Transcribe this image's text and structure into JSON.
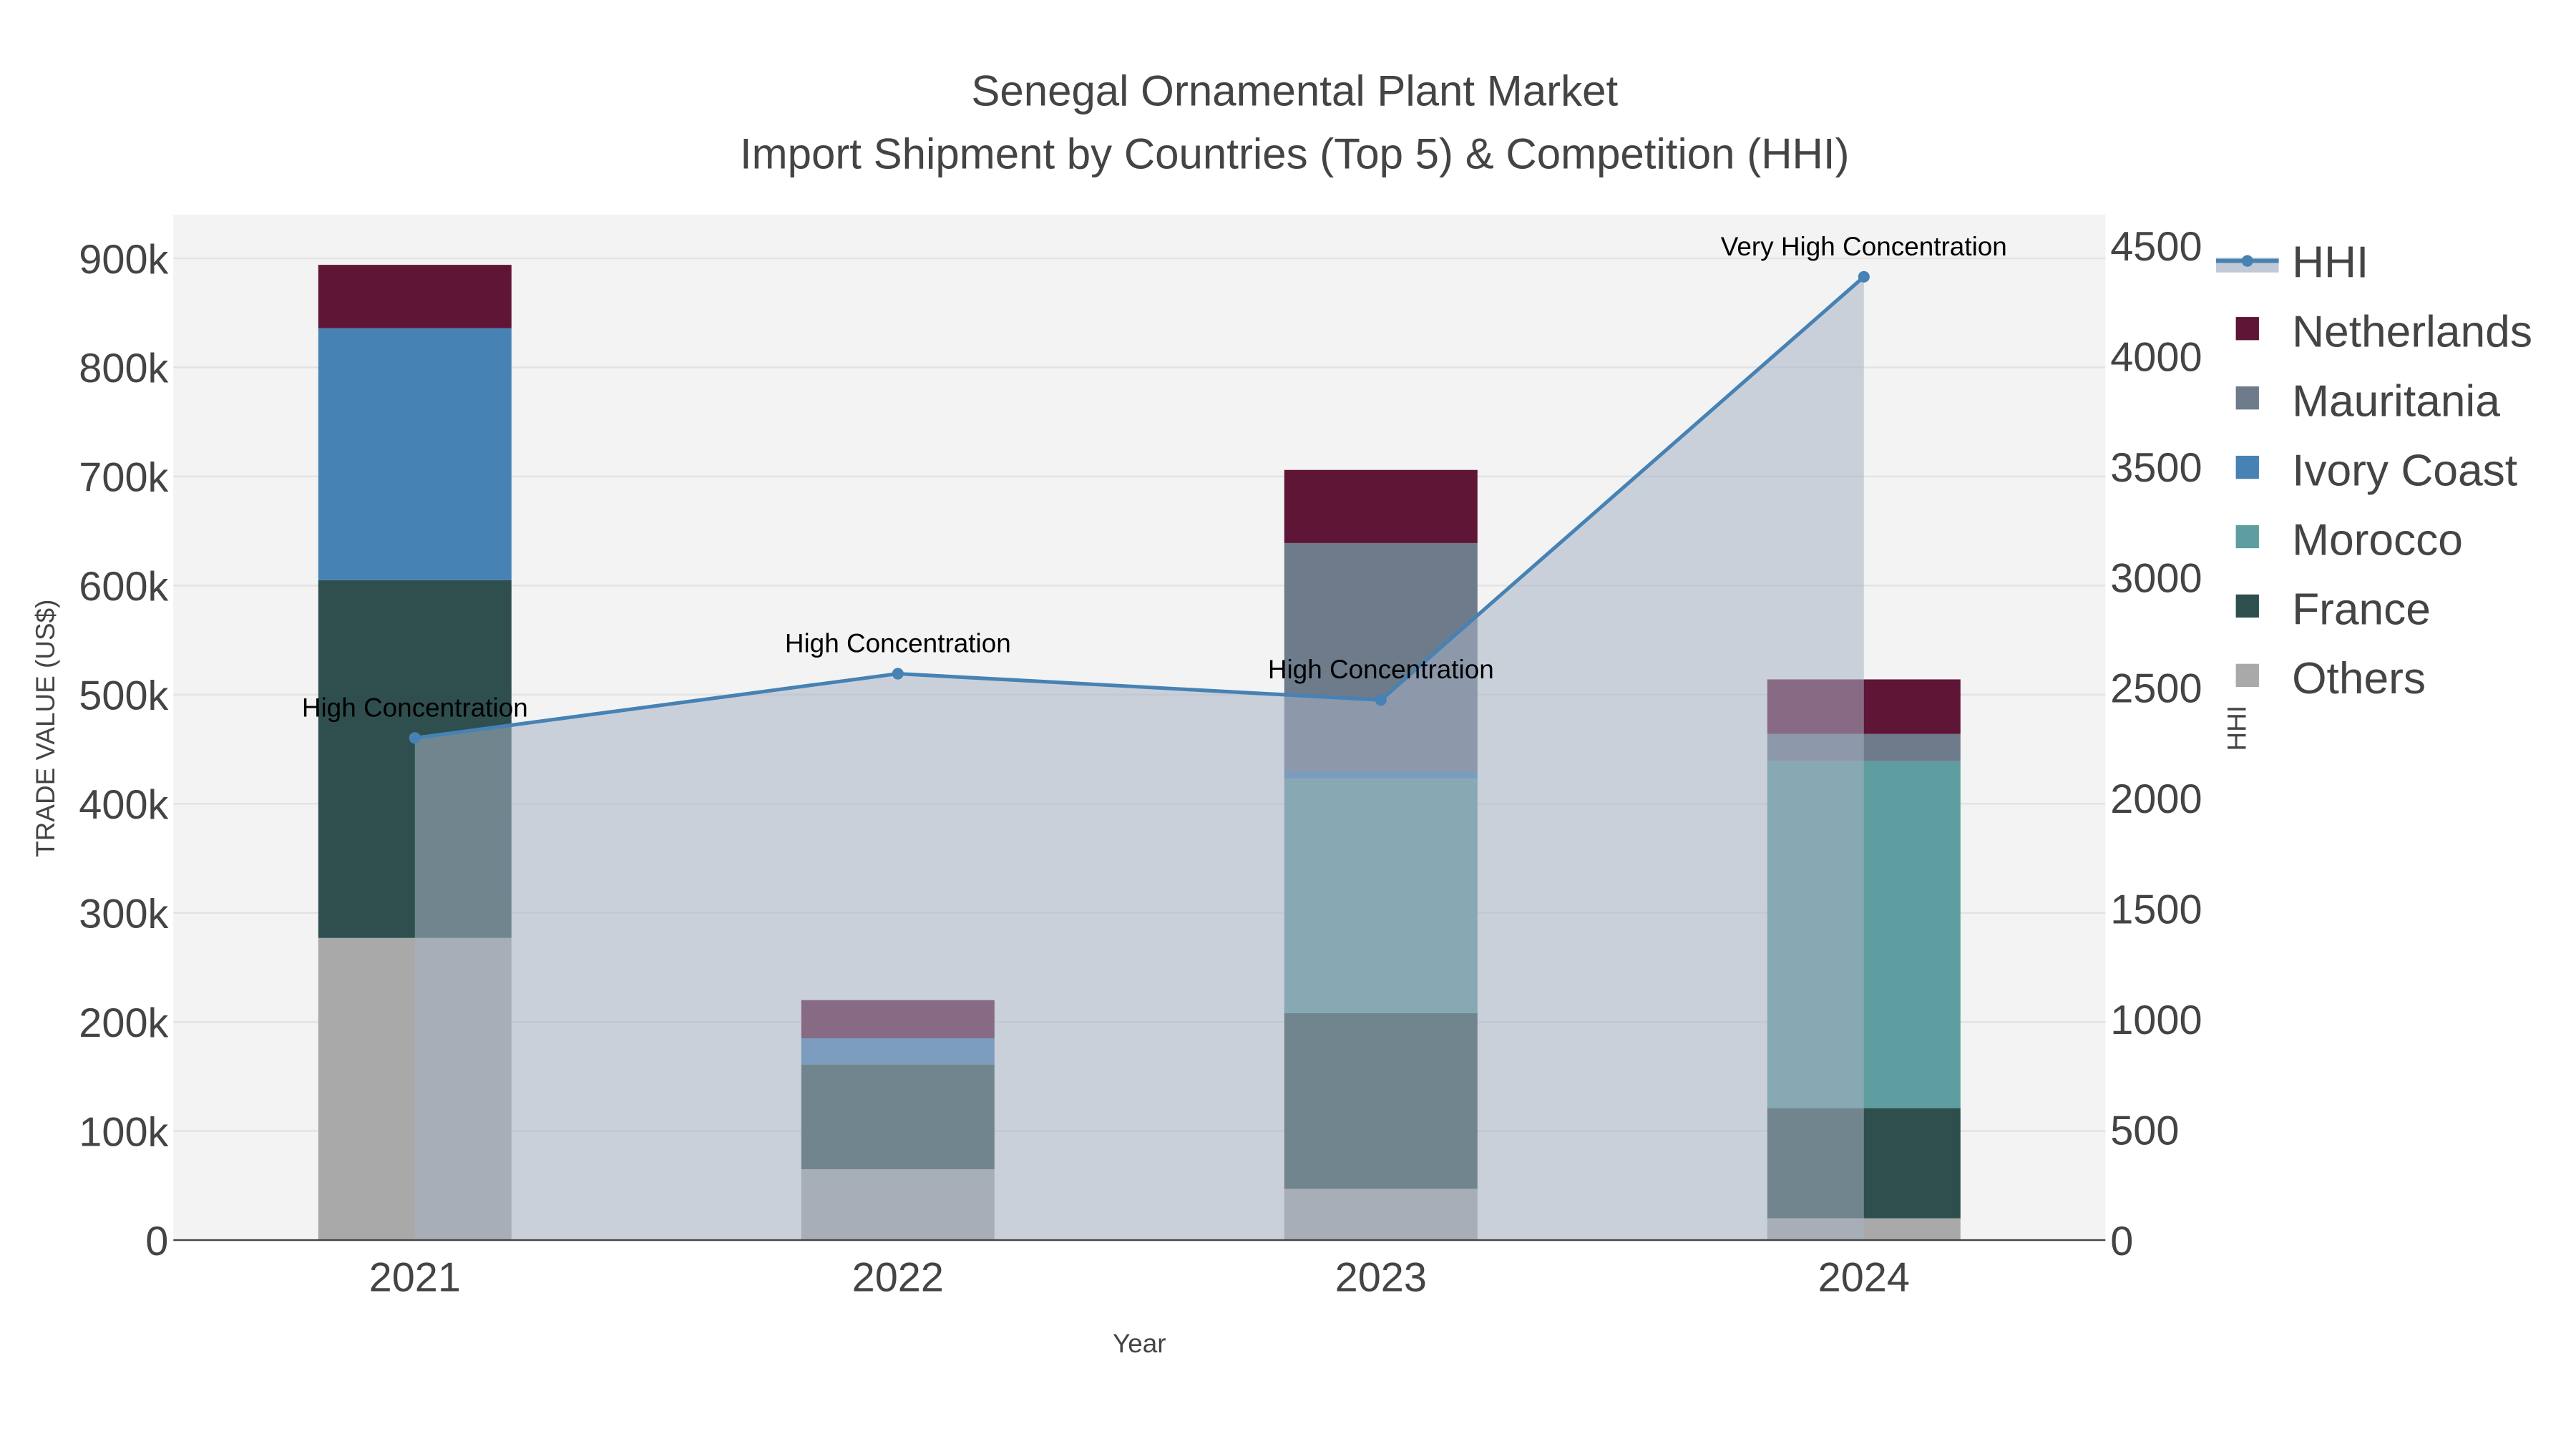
{
  "chart_data": {
    "type": "bar",
    "barmode": "stack",
    "title": "Senegal Ornamental Plant Market",
    "subtitle": "Import Shipment by Countries (Top 5) & Competition (HHI)",
    "xlabel": "Year",
    "ylabel": "TRADE VALUE (US$)",
    "y2label": "HHI",
    "categories": [
      "2021",
      "2022",
      "2023",
      "2024"
    ],
    "ylim": [
      0,
      940000
    ],
    "y2lim": [
      0,
      4640
    ],
    "yticks": [
      0,
      100000,
      200000,
      300000,
      400000,
      500000,
      600000,
      700000,
      800000,
      900000
    ],
    "ytick_labels": [
      "0",
      "100k",
      "200k",
      "300k",
      "400k",
      "500k",
      "600k",
      "700k",
      "800k",
      "900k"
    ],
    "y2ticks": [
      0,
      500,
      1000,
      1500,
      2000,
      2500,
      3000,
      3500,
      4000,
      4500
    ],
    "y2tick_labels": [
      "0",
      "500",
      "1000",
      "1500",
      "2000",
      "2500",
      "3000",
      "3500",
      "4000",
      "4500"
    ],
    "grid": true,
    "legend_placement": "right",
    "series": [
      {
        "name": "Others",
        "color": "#a9a9a9",
        "values": [
          277000,
          65000,
          47000,
          20000
        ]
      },
      {
        "name": "France",
        "color": "#2f4f4f",
        "values": [
          328000,
          96000,
          161000,
          101000
        ]
      },
      {
        "name": "Morocco",
        "color": "#5f9ea0",
        "values": [
          0,
          0,
          215000,
          318000
        ]
      },
      {
        "name": "Ivory Coast",
        "color": "#4682b4",
        "values": [
          231000,
          24000,
          7000,
          0
        ]
      },
      {
        "name": "Mauritania",
        "color": "#6e7b8b",
        "values": [
          0,
          0,
          209000,
          25000
        ]
      },
      {
        "name": "Netherlands",
        "color": "#5f1535",
        "values": [
          58000,
          35000,
          67000,
          50000
        ]
      }
    ],
    "line": {
      "name": "HHI",
      "color": "#4682b4",
      "values": [
        2272,
        2563,
        2444,
        4359
      ],
      "annotations": [
        "High Concentration",
        "High Concentration",
        "High Concentration",
        "Very High Concentration"
      ]
    },
    "legend_order": [
      "HHI",
      "Netherlands",
      "Mauritania",
      "Ivory Coast",
      "Morocco",
      "France",
      "Others"
    ]
  }
}
